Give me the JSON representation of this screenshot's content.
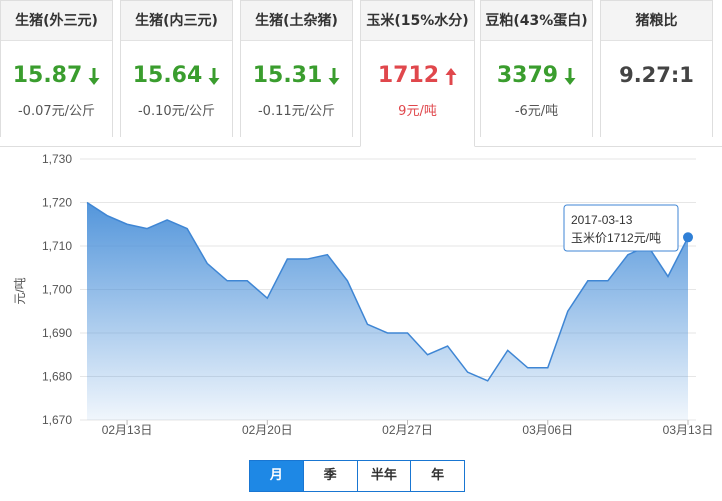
{
  "cards": [
    {
      "title": "生猪(外三元)",
      "price": "15.87",
      "direction": "down",
      "change": "-0.07元/公斤"
    },
    {
      "title": "生猪(内三元)",
      "price": "15.64",
      "direction": "down",
      "change": "-0.10元/公斤"
    },
    {
      "title": "生猪(土杂猪)",
      "price": "15.31",
      "direction": "down",
      "change": "-0.11元/公斤"
    },
    {
      "title": "玉米(15%水分)",
      "price": "1712",
      "direction": "up",
      "change": "9元/吨",
      "active": true
    },
    {
      "title": "豆粕(43%蛋白)",
      "price": "3379",
      "direction": "down",
      "change": "-6元/吨"
    },
    {
      "title": "猪粮比",
      "price": "9.27:1"
    }
  ],
  "colors": {
    "down": "#3a9d2e",
    "up": "#e0474c",
    "accent": "#1e88e5",
    "line": "#4a90d9"
  },
  "tooltip": {
    "date": "2017-03-13",
    "text": "玉米价1712元/吨"
  },
  "tabs": [
    {
      "label": "月",
      "active": true
    },
    {
      "label": "季"
    },
    {
      "label": "半年"
    },
    {
      "label": "年"
    }
  ],
  "chart_data": {
    "type": "area",
    "ylabel": "元/吨",
    "ylim": [
      1670,
      1730
    ],
    "yticks": [
      1670,
      1680,
      1690,
      1700,
      1710,
      1720,
      1730
    ],
    "ytick_labels": [
      "1,670",
      "1,680",
      "1,690",
      "1,700",
      "1,710",
      "1,720",
      "1,730"
    ],
    "xtick_labels": [
      {
        "label": "02月13日",
        "index": 2
      },
      {
        "label": "02月20日",
        "index": 9
      },
      {
        "label": "02月27日",
        "index": 16
      },
      {
        "label": "03月06日",
        "index": 23
      },
      {
        "label": "03月13日",
        "index": 30
      }
    ],
    "x": [
      "02-11",
      "02-12",
      "02-13",
      "02-14",
      "02-15",
      "02-16",
      "02-17",
      "02-18",
      "02-19",
      "02-20",
      "02-21",
      "02-22",
      "02-23",
      "02-24",
      "02-25",
      "02-26",
      "02-27",
      "02-28",
      "03-01",
      "03-02",
      "03-03",
      "03-04",
      "03-05",
      "03-06",
      "03-07",
      "03-08",
      "03-09",
      "03-10",
      "03-11",
      "03-12",
      "03-13"
    ],
    "values": [
      1720,
      1717,
      1715,
      1714,
      1716,
      1714,
      1706,
      1702,
      1702,
      1698,
      1707,
      1707,
      1708,
      1702,
      1692,
      1690,
      1690,
      1685,
      1687,
      1681,
      1679,
      1686,
      1682,
      1682,
      1695,
      1702,
      1702,
      1708,
      1710,
      1703,
      1712
    ],
    "grid": true,
    "legend": "none"
  }
}
